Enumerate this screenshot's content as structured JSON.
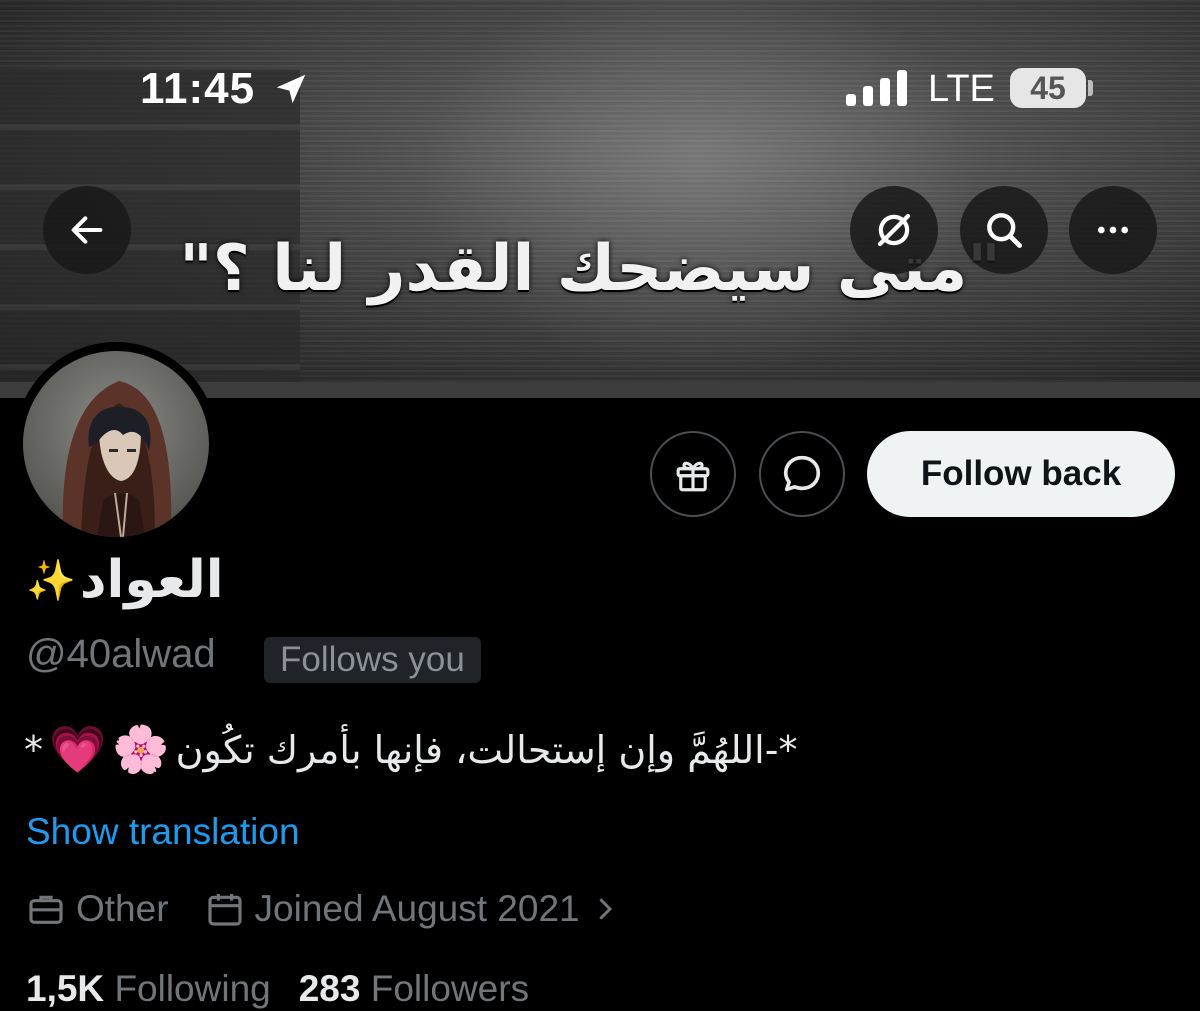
{
  "status_bar": {
    "time": "11:45",
    "network": "LTE",
    "battery": "45"
  },
  "banner": {
    "quote": "\"متى سيضحك القدر لنا ؟\""
  },
  "header": {
    "back_icon": "arrow-left-icon",
    "grok_icon": "slashed-circle-icon",
    "search_icon": "search-icon",
    "more_icon": "ellipsis-icon"
  },
  "actions": {
    "gift_icon": "gift-icon",
    "message_icon": "message-bubble-icon",
    "follow_back_label": "Follow back"
  },
  "profile": {
    "display_name": "العواد",
    "display_name_emoji": "✨",
    "handle": "@40alwad",
    "follows_you_badge": "Follows you",
    "bio_text": "*-اللهُمَّ وإن إستحالت، فإنها بأمرك تكُون",
    "bio_emoji_flower": "🌸",
    "bio_emoji_heart": "💗",
    "bio_suffix": "*",
    "show_translation": "Show translation",
    "category": "Other",
    "joined": "Joined August 2021",
    "following_count": "1,5K",
    "following_label": "Following",
    "followers_count": "283",
    "followers_label": "Followers"
  },
  "colors": {
    "background": "#000000",
    "link": "#1d9bf0",
    "muted": "#71767b",
    "follow_button_bg": "#eff3f4"
  }
}
